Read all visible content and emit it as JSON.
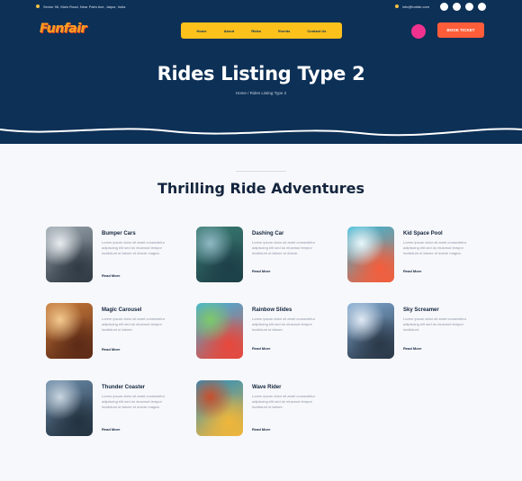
{
  "page": {
    "title": "Rides Listing Type 2",
    "breadcrumb": "Home  /  Rides Listing Type 2"
  },
  "topbar": {
    "address": "Sector 96, Main Road, Near Palm Ave, Jaipur, India",
    "email": "info@funfair.com"
  },
  "header": {
    "logo": "Funfair",
    "nav": [
      "Home",
      "About",
      "Rides",
      "Events",
      "Contact Us"
    ],
    "book_label": "BOOK TICKET"
  },
  "section": {
    "title": "Thrilling Ride Adventures"
  },
  "rides": [
    {
      "name": "Bumper Cars",
      "desc": "Lorem ipsum dolor sit amet consectetur adipiscing elit sed do eiusmod tempor incididunt ut labore et dolore magna.",
      "link": "Read More",
      "palette": [
        "#9aa5ae",
        "#2f3a44",
        "#e8ecef"
      ]
    },
    {
      "name": "Dashing Car",
      "desc": "Lorem ipsum dolor sit amet consectetur adipiscing elit sed do eiusmod tempor incididunt ut labore et dolore.",
      "link": "Read More",
      "palette": [
        "#3b7d74",
        "#1d3f47",
        "#8fb8c4"
      ]
    },
    {
      "name": "Kid Space Pool",
      "desc": "Lorem ipsum dolor sit amet consectetur adipiscing elit sed do eiusmod tempor incididunt ut labore et dolore magna.",
      "link": "Read More",
      "palette": [
        "#36b9d8",
        "#f35d3b",
        "#e8f6fb"
      ]
    },
    {
      "name": "Magic Carousel",
      "desc": "Lorem ipsum dolor sit amet consectetur adipiscing elit sed do eiusmod tempor incididunt ut labore.",
      "link": "Read More",
      "palette": [
        "#c87a3a",
        "#5c2a16",
        "#f2c98f"
      ]
    },
    {
      "name": "Rainbow Slides",
      "desc": "Lorem ipsum dolor sit amet consectetur adipiscing elit sed do eiusmod tempor incididunt ut labore.",
      "link": "Read More",
      "palette": [
        "#3fb5e0",
        "#e8473b",
        "#7dc96b"
      ]
    },
    {
      "name": "Sky Screamer",
      "desc": "Lorem ipsum dolor sit amet consectetur adipiscing elit sed do eiusmod tempor incididunt.",
      "link": "Read More",
      "palette": [
        "#7fa8d0",
        "#2a3848",
        "#dfe9f4"
      ]
    },
    {
      "name": "Thunder Coaster",
      "desc": "Lorem ipsum dolor sit amet consectetur adipiscing elit sed do eiusmod tempor incididunt ut labore et dolore magna.",
      "link": "Read More",
      "palette": [
        "#6a8aa8",
        "#23323f",
        "#c9d5e0"
      ]
    },
    {
      "name": "Wave Rider",
      "desc": "Lorem ipsum dolor sit amet consectetur adipiscing elit sed do eiusmod tempor incididunt ut labore.",
      "link": "Read More",
      "palette": [
        "#2a8fbf",
        "#f0b63a",
        "#c74f2c"
      ]
    }
  ],
  "colors": {
    "navy": "#0d3056",
    "nav_yellow": "#fcc21b",
    "button_orange": "#ff5d39",
    "cart_pink": "#f0328e"
  }
}
